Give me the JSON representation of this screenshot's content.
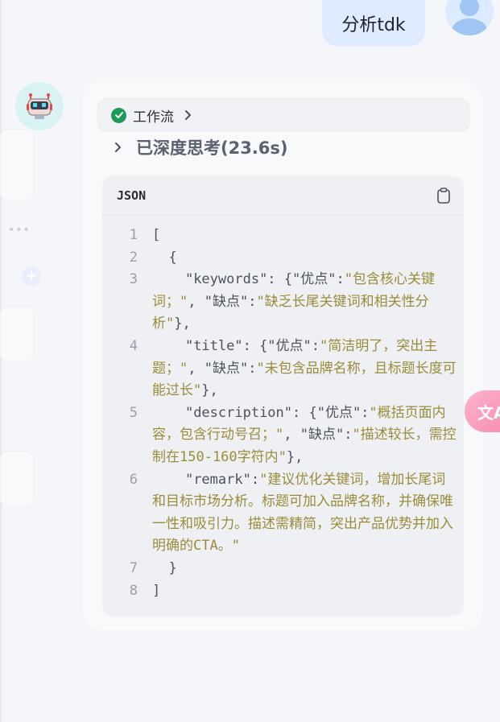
{
  "user_message": {
    "text": "分析tdk"
  },
  "assistant": {
    "workflow_label": "工作流",
    "thinking_label": "已深度思考(23.6s)",
    "code": {
      "language": "JSON",
      "lines": [
        {
          "n": "1",
          "segments": [
            {
              "t": "[",
              "c": "pun"
            }
          ]
        },
        {
          "n": "2",
          "segments": [
            {
              "t": "  {",
              "c": "pun"
            }
          ]
        },
        {
          "n": "3",
          "segments": [
            {
              "t": "    \"keywords\": {\"优点\":",
              "c": "pun"
            },
            {
              "t": "\"包含核心关键词；\"",
              "c": "str"
            },
            {
              "t": ", \"缺点\":",
              "c": "pun"
            },
            {
              "t": "\"缺乏长尾关键词和相关性分析\"",
              "c": "str"
            },
            {
              "t": "},",
              "c": "pun"
            }
          ]
        },
        {
          "n": "4",
          "segments": [
            {
              "t": "    \"title\": {\"优点\":",
              "c": "pun"
            },
            {
              "t": "\"简洁明了，突出主题；\"",
              "c": "str"
            },
            {
              "t": ", \"缺点\":",
              "c": "pun"
            },
            {
              "t": "\"未包含品牌名称，且标题长度可能过长\"",
              "c": "str"
            },
            {
              "t": "},",
              "c": "pun"
            }
          ]
        },
        {
          "n": "5",
          "segments": [
            {
              "t": "    \"description\": {\"优点\":",
              "c": "pun"
            },
            {
              "t": "\"概括页面内容，包含行动号召；\"",
              "c": "str"
            },
            {
              "t": ", \"缺点\":",
              "c": "pun"
            },
            {
              "t": "\"描述较长，需控制在150-160字符内\"",
              "c": "str"
            },
            {
              "t": "},",
              "c": "pun"
            }
          ]
        },
        {
          "n": "6",
          "segments": [
            {
              "t": "    \"remark\":",
              "c": "pun"
            },
            {
              "t": "\"建议优化关键词，增加长尾词和目标市场分析。标题可加入品牌名称，并确保唯一性和吸引力。描述需精简，突出产品优势并加入明确的CTA。\"",
              "c": "str"
            }
          ]
        },
        {
          "n": "7",
          "segments": [
            {
              "t": "  }",
              "c": "pun"
            }
          ]
        },
        {
          "n": "8",
          "segments": [
            {
              "t": "]",
              "c": "pun"
            }
          ]
        }
      ]
    }
  },
  "translate_fab": {
    "label": "文A"
  },
  "icons": {
    "bot_avatar": "robot-icon",
    "user_avatar": "user-avatar-icon",
    "check": "check-circle-icon",
    "chevron": "chevron-right-icon",
    "copy": "clipboard-icon",
    "translate": "translate-icon",
    "add": "plus-icon"
  },
  "colors": {
    "user_bubble": "#deebff",
    "check_green": "#1a9b5a",
    "string_olive": "#9a8c3a",
    "fab_pink": "#f58bb0"
  }
}
